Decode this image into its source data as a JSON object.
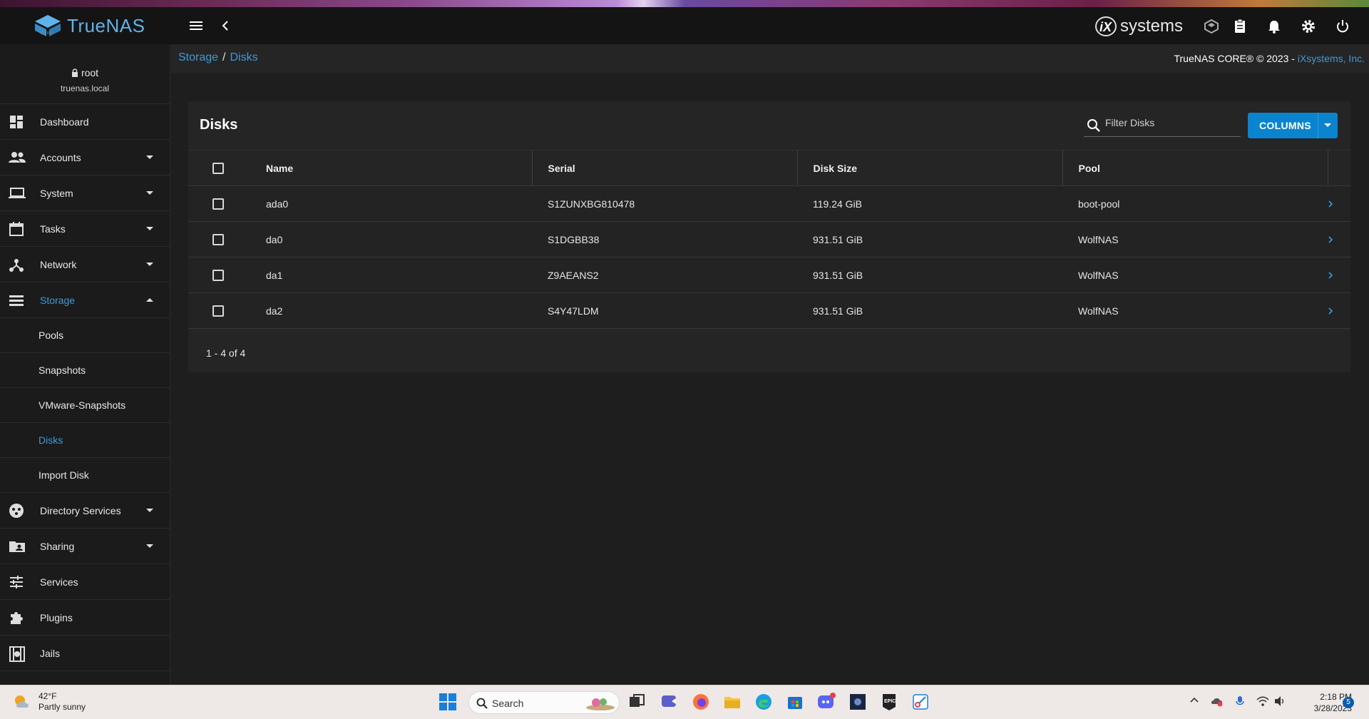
{
  "app": {
    "name": "TrueNAS",
    "edition": "CORE",
    "vendor_logo": "iXsystems"
  },
  "user": {
    "name": "root",
    "host": "truenas.local"
  },
  "sidebar": {
    "items": [
      {
        "label": "Dashboard",
        "icon": "dashboard-icon"
      },
      {
        "label": "Accounts",
        "icon": "people-icon"
      },
      {
        "label": "System",
        "icon": "laptop-icon"
      },
      {
        "label": "Tasks",
        "icon": "calendar-icon"
      },
      {
        "label": "Network",
        "icon": "network-icon"
      },
      {
        "label": "Storage",
        "icon": "storage-icon"
      }
    ],
    "storage_children": [
      "Pools",
      "Snapshots",
      "VMware-Snapshots",
      "Disks",
      "Import Disk"
    ],
    "items_after": [
      {
        "label": "Directory Services",
        "icon": "directory-icon"
      },
      {
        "label": "Sharing",
        "icon": "folder-share-icon"
      },
      {
        "label": "Services",
        "icon": "sliders-icon"
      },
      {
        "label": "Plugins",
        "icon": "puzzle-icon"
      },
      {
        "label": "Jails",
        "icon": "jail-icon"
      }
    ]
  },
  "breadcrumb": {
    "parent": "Storage",
    "separator": "/",
    "current": "Disks"
  },
  "copyright": {
    "text": "TrueNAS CORE® © 2023 - ",
    "link": "iXsystems, Inc."
  },
  "card": {
    "title": "Disks",
    "filter_placeholder": "Filter Disks",
    "columns_button": "COLUMNS",
    "headers": [
      "Name",
      "Serial",
      "Disk Size",
      "Pool"
    ],
    "rows": [
      {
        "name": "ada0",
        "serial": "S1ZUNXBG810478",
        "size": "119.24 GiB",
        "pool": "boot-pool"
      },
      {
        "name": "da0",
        "serial": "S1DGBB38",
        "size": "931.51 GiB",
        "pool": "WolfNAS"
      },
      {
        "name": "da1",
        "serial": "Z9AEANS2",
        "size": "931.51 GiB",
        "pool": "WolfNAS"
      },
      {
        "name": "da2",
        "serial": "S4Y47LDM",
        "size": "931.51 GiB",
        "pool": "WolfNAS"
      }
    ],
    "pagination": "1 - 4 of 4"
  },
  "taskbar": {
    "weather_temp": "42°F",
    "weather_desc": "Partly sunny",
    "search_label": "Search",
    "time": "2:18 PM",
    "date": "3/28/2023",
    "notification_count": "5"
  },
  "colors": {
    "accent": "#0a84cf",
    "link": "#3c9ad8",
    "background": "#1e1e1e",
    "card": "#252525"
  }
}
